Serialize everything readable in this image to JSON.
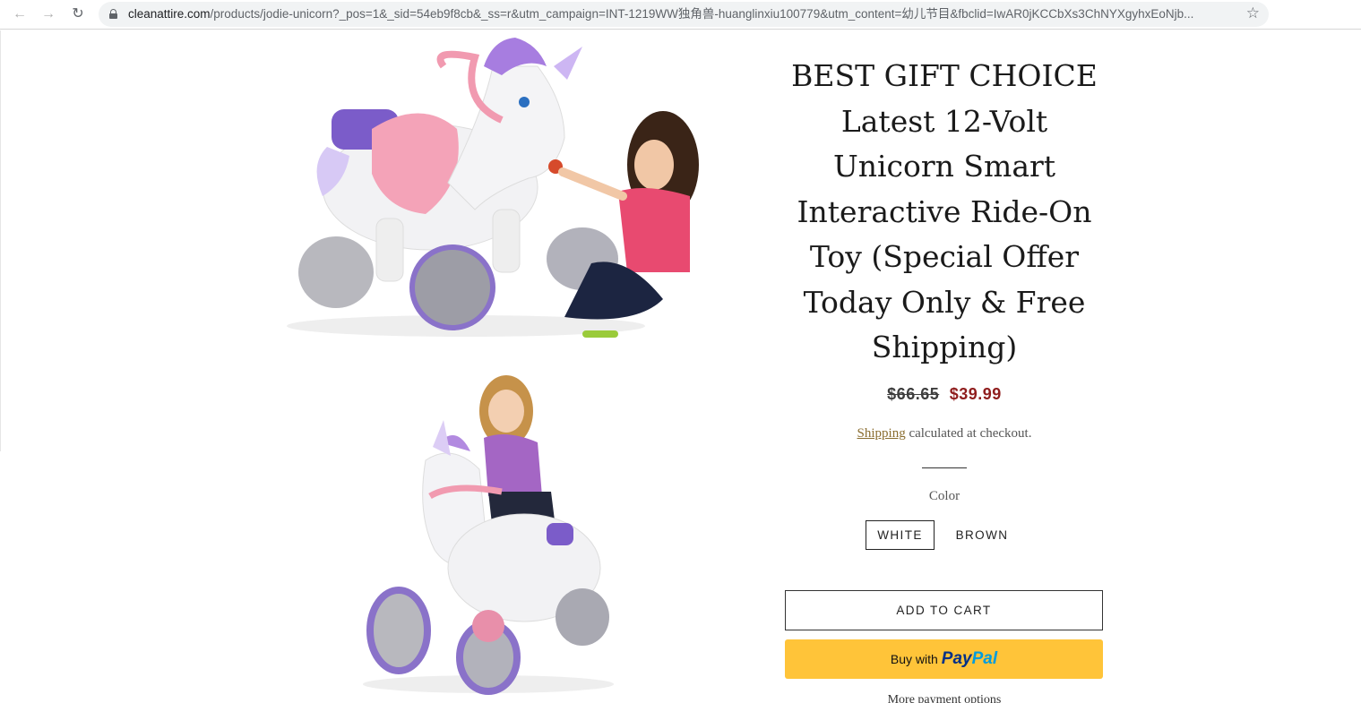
{
  "browser": {
    "url_host": "cleanattire.com",
    "url_rest": "/products/jodie-unicorn?_pos=1&_sid=54eb9f8cb&_ss=r&utm_campaign=INT-1219WW独角兽-huanglinxiu100779&utm_content=幼儿节目&fbclid=IwAR0jKCCbXs3ChNYXgyhxEoNjb..."
  },
  "product": {
    "title": "BEST GIFT CHOICE Latest 12-Volt Unicorn Smart Interactive Ride-On Toy (Special Offer Today Only & Free Shipping)",
    "title_lines": [
      "BEST GIFT CHOICE",
      "Latest 12-Volt",
      "Unicorn Smart",
      "Interactive Ride-On",
      "Toy (Special Offer",
      "Today Only & Free",
      "Shipping)"
    ],
    "compare_price": "$66.65",
    "price": "$39.99",
    "shipping_link": "Shipping",
    "shipping_text": " calculated at checkout.",
    "color_label": "Color",
    "colors": [
      "WHITE",
      "BROWN"
    ],
    "selected_color": "WHITE",
    "add_to_cart": "ADD TO CART",
    "paypal_prefix": "Buy with",
    "paypal_brand_1": "Pay",
    "paypal_brand_2": "Pal",
    "more_options": "More payment options"
  },
  "colors": {
    "price_sale": "#8f1d1d",
    "paypal_bg": "#ffc439",
    "paypal_dark": "#003087",
    "paypal_light": "#009cde",
    "link_gold": "#8a6d2f"
  }
}
